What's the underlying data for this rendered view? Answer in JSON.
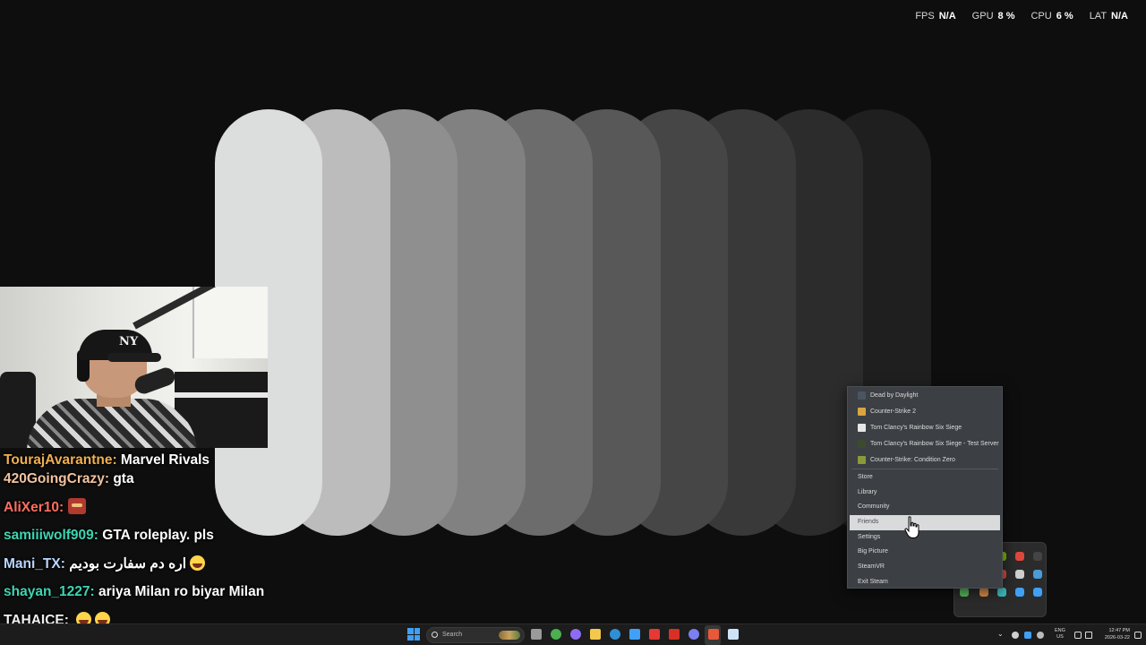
{
  "stats": [
    {
      "label": "FPS",
      "value": "N/A"
    },
    {
      "label": "GPU",
      "value": "8 %"
    },
    {
      "label": "CPU",
      "value": "6 %"
    },
    {
      "label": "LAT",
      "value": "N/A"
    }
  ],
  "loading_pills": {
    "colors": [
      "#dcdedd",
      "#bbbcbb",
      "#8f8f8f",
      "#818181",
      "#6b6c6b",
      "#575857",
      "#454645",
      "#383938",
      "#2b2c2b",
      "#1e1f1e"
    ]
  },
  "chat": [
    {
      "user": "TourajAvarantne",
      "color": "#f0b050",
      "message": "Marvel Rivals"
    },
    {
      "user": "420GoingCrazy",
      "color": "#f3c3a0",
      "message": "gta"
    },
    {
      "user": "AliXer10",
      "color": "#ff6f61",
      "message": "",
      "emote": "custom-emote"
    },
    {
      "user": "samiiiwolf909",
      "color": "#3dd6b3",
      "message": "GTA roleplay. pls"
    },
    {
      "user": "Mani_TX",
      "color": "#b9d6ff",
      "message": "اره دم سفارت بودیم",
      "emote": "laughing-emoji"
    },
    {
      "user": "shayan_1227",
      "color": "#3dd6b3",
      "message": "ariya Milan ro biyar Milan"
    },
    {
      "user": "TAHAICE",
      "color": "#f0f0f0",
      "message": "",
      "emote": "laughing-emoji-x2"
    }
  ],
  "steam_menu": {
    "games": [
      {
        "label": "Dead by Daylight",
        "icon": "dead-by-daylight-icon",
        "color": "#4a5560"
      },
      {
        "label": "Counter-Strike 2",
        "icon": "counter-strike-2-icon",
        "color": "#d9a441"
      },
      {
        "label": "Tom Clancy's Rainbow Six Siege",
        "icon": "rainbow-six-icon",
        "color": "#e6e6e6"
      },
      {
        "label": "Tom Clancy's Rainbow Six Siege - Test Server",
        "icon": "rainbow-six-test-icon",
        "color": "#3e4a2e"
      },
      {
        "label": "Counter-Strike: Condition Zero",
        "icon": "condition-zero-icon",
        "color": "#8a9a3a"
      }
    ],
    "items": [
      {
        "label": "Store",
        "active": false
      },
      {
        "label": "Library",
        "active": false
      },
      {
        "label": "Community",
        "active": false
      },
      {
        "label": "Friends",
        "active": true
      },
      {
        "label": "Settings",
        "active": false
      },
      {
        "label": "Big Picture",
        "active": false
      },
      {
        "label": "SteamVR",
        "active": false
      },
      {
        "label": "Exit Steam",
        "active": false
      }
    ]
  },
  "tray_icons": [
    {
      "name": "tray-icon-1",
      "color": "#3b3b3b"
    },
    {
      "name": "tray-icon-2",
      "color": "#6bd36b"
    },
    {
      "name": "tray-icon-3",
      "color": "#76b900"
    },
    {
      "name": "tray-icon-4",
      "color": "#e0473c"
    },
    {
      "name": "tray-icon-5",
      "color": "#444"
    },
    {
      "name": "tray-icon-6",
      "color": "#e0473c"
    },
    {
      "name": "tray-icon-7",
      "color": "#cfcfcf"
    },
    {
      "name": "tray-icon-8",
      "color": "#d64a3b"
    },
    {
      "name": "tray-icon-9",
      "color": "#cfcfcf"
    },
    {
      "name": "tray-icon-10",
      "color": "#4a9bd6"
    },
    {
      "name": "tray-icon-11",
      "color": "#5bbd5b"
    },
    {
      "name": "tray-icon-12",
      "color": "#e0904a"
    },
    {
      "name": "tray-icon-13",
      "color": "#3fbfbf"
    },
    {
      "name": "tray-icon-14",
      "color": "#3fa0f5"
    },
    {
      "name": "tray-icon-15",
      "color": "#3fa0f5"
    }
  ],
  "taskbar": {
    "search_placeholder": "Search",
    "apps": [
      {
        "name": "file-explorer-icon",
        "color": "#9a9a9a"
      },
      {
        "name": "chrome-icon",
        "color": "#4caf50"
      },
      {
        "name": "copilot-icon",
        "color": "#8e6cf2"
      },
      {
        "name": "folder-icon",
        "color": "#f2c94c"
      },
      {
        "name": "edge-icon",
        "color": "#2f8fd6"
      },
      {
        "name": "store-icon",
        "color": "#3fa0f5"
      },
      {
        "name": "youtube-icon",
        "color": "#e53935"
      },
      {
        "name": "gmail-icon",
        "color": "#d93025"
      },
      {
        "name": "discord-icon",
        "color": "#7b7ff0"
      },
      {
        "name": "recording-app-icon",
        "color": "#e8583a"
      },
      {
        "name": "steam-icon",
        "color": "#cfe3f7"
      }
    ],
    "language_top": "ENG",
    "language_bottom": "US",
    "time": "12:47 PM",
    "date": "2026-03-22"
  }
}
